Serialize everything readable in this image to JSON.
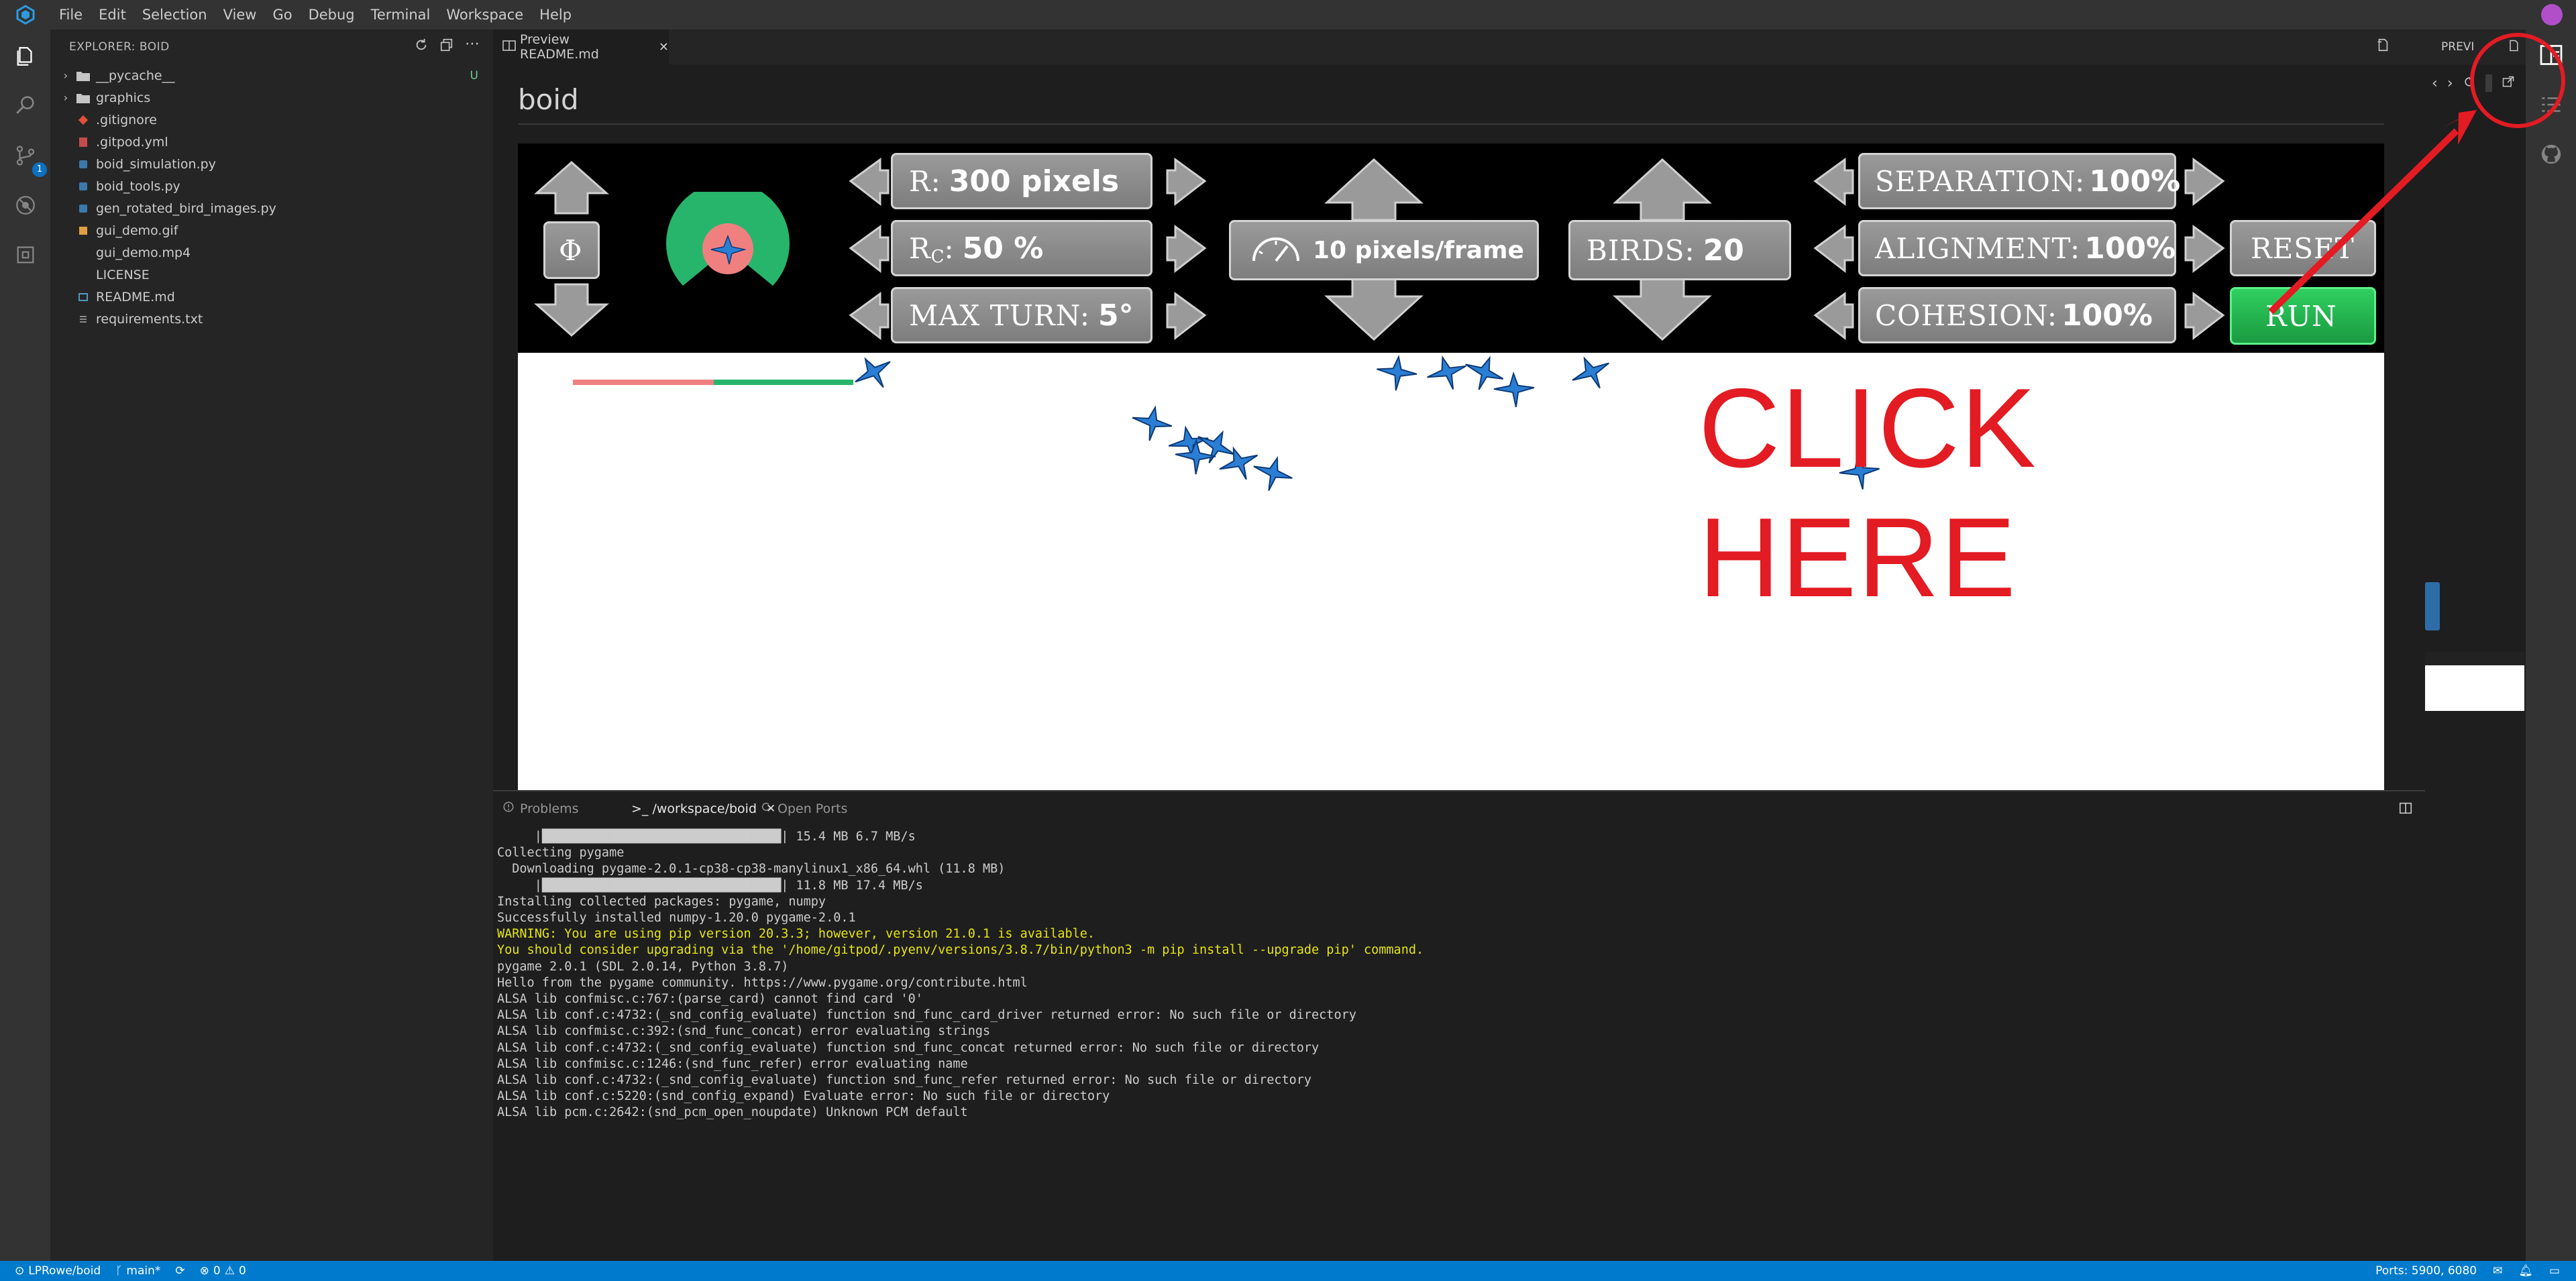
{
  "menubar": {
    "items": [
      "File",
      "Edit",
      "Selection",
      "View",
      "Go",
      "Debug",
      "Terminal",
      "Workspace",
      "Help"
    ]
  },
  "activity": {
    "scm_badge": "1"
  },
  "explorer": {
    "title": "EXPLORER: BOID",
    "items": [
      {
        "name": "__pycache__",
        "type": "folder",
        "badge": "U"
      },
      {
        "name": "graphics",
        "type": "folder"
      },
      {
        "name": ".gitignore",
        "type": "git"
      },
      {
        "name": ".gitpod.yml",
        "type": "yml"
      },
      {
        "name": "boid_simulation.py",
        "type": "py"
      },
      {
        "name": "boid_tools.py",
        "type": "py"
      },
      {
        "name": "gen_rotated_bird_images.py",
        "type": "py"
      },
      {
        "name": "gui_demo.gif",
        "type": "gif"
      },
      {
        "name": "gui_demo.mp4",
        "type": "file"
      },
      {
        "name": "LICENSE",
        "type": "file"
      },
      {
        "name": "README.md",
        "type": "md"
      },
      {
        "name": "requirements.txt",
        "type": "txt"
      }
    ]
  },
  "editor": {
    "tab_label": "Preview README.md",
    "doc_title": "boid"
  },
  "boid_gui": {
    "phi_label": "Φ",
    "r_label": "R:",
    "r_value": "300 pixels",
    "rc_label": "R",
    "rc_sub": "C",
    "rc_value": "50 %",
    "max_turn_label": "MAX TURN:",
    "max_turn_value": "5°",
    "speed_value": "10 pixels/frame",
    "birds_label": "BIRDS:",
    "birds_value": "20",
    "separation_label": "SEPARATION:",
    "separation_value": "100%",
    "alignment_label": "ALIGNMENT:",
    "alignment_value": "100%",
    "cohesion_label": "COHESION:",
    "cohesion_value": "100%",
    "reset_label": "RESET",
    "run_label": "RUN",
    "click_here": "CLICK HERE",
    "colors": {
      "run": "#22b14c",
      "click": "#e31b23",
      "bird": "#2a7fd4"
    }
  },
  "preview2": {
    "tab_label": "PREVI"
  },
  "panel": {
    "tabs": [
      "Problems",
      ">_ /workspace/boid",
      "Open Ports"
    ],
    "terminal_lines": [
      {
        "text": "     |████████████████████████████████| 15.4 MB 6.7 MB/s",
        "warn": false
      },
      {
        "text": "Collecting pygame",
        "warn": false
      },
      {
        "text": "  Downloading pygame-2.0.1-cp38-cp38-manylinux1_x86_64.whl (11.8 MB)",
        "warn": false
      },
      {
        "text": "     |████████████████████████████████| 11.8 MB 17.4 MB/s",
        "warn": false
      },
      {
        "text": "Installing collected packages: pygame, numpy",
        "warn": false
      },
      {
        "text": "Successfully installed numpy-1.20.0 pygame-2.0.1",
        "warn": false
      },
      {
        "text": "WARNING: You are using pip version 20.3.3; however, version 21.0.1 is available.",
        "warn": true
      },
      {
        "text": "You should consider upgrading via the '/home/gitpod/.pyenv/versions/3.8.7/bin/python3 -m pip install --upgrade pip' command.",
        "warn": true
      },
      {
        "text": "pygame 2.0.1 (SDL 2.0.14, Python 3.8.7)",
        "warn": false
      },
      {
        "text": "Hello from the pygame community. https://www.pygame.org/contribute.html",
        "warn": false
      },
      {
        "text": "ALSA lib confmisc.c:767:(parse_card) cannot find card '0'",
        "warn": false
      },
      {
        "text": "ALSA lib conf.c:4732:(_snd_config_evaluate) function snd_func_card_driver returned error: No such file or directory",
        "warn": false
      },
      {
        "text": "ALSA lib confmisc.c:392:(snd_func_concat) error evaluating strings",
        "warn": false
      },
      {
        "text": "ALSA lib conf.c:4732:(_snd_config_evaluate) function snd_func_concat returned error: No such file or directory",
        "warn": false
      },
      {
        "text": "ALSA lib confmisc.c:1246:(snd_func_refer) error evaluating name",
        "warn": false
      },
      {
        "text": "ALSA lib conf.c:4732:(_snd_config_evaluate) function snd_func_refer returned error: No such file or directory",
        "warn": false
      },
      {
        "text": "ALSA lib conf.c:5220:(snd_config_expand) Evaluate error: No such file or directory",
        "warn": false
      },
      {
        "text": "ALSA lib pcm.c:2642:(snd_pcm_open_noupdate) Unknown PCM default",
        "warn": false
      }
    ]
  },
  "statusbar": {
    "repo": "LPRowe/boid",
    "branch": "main*",
    "errors": "0",
    "warnings": "0",
    "ports": "Ports: 5900, 6080"
  }
}
